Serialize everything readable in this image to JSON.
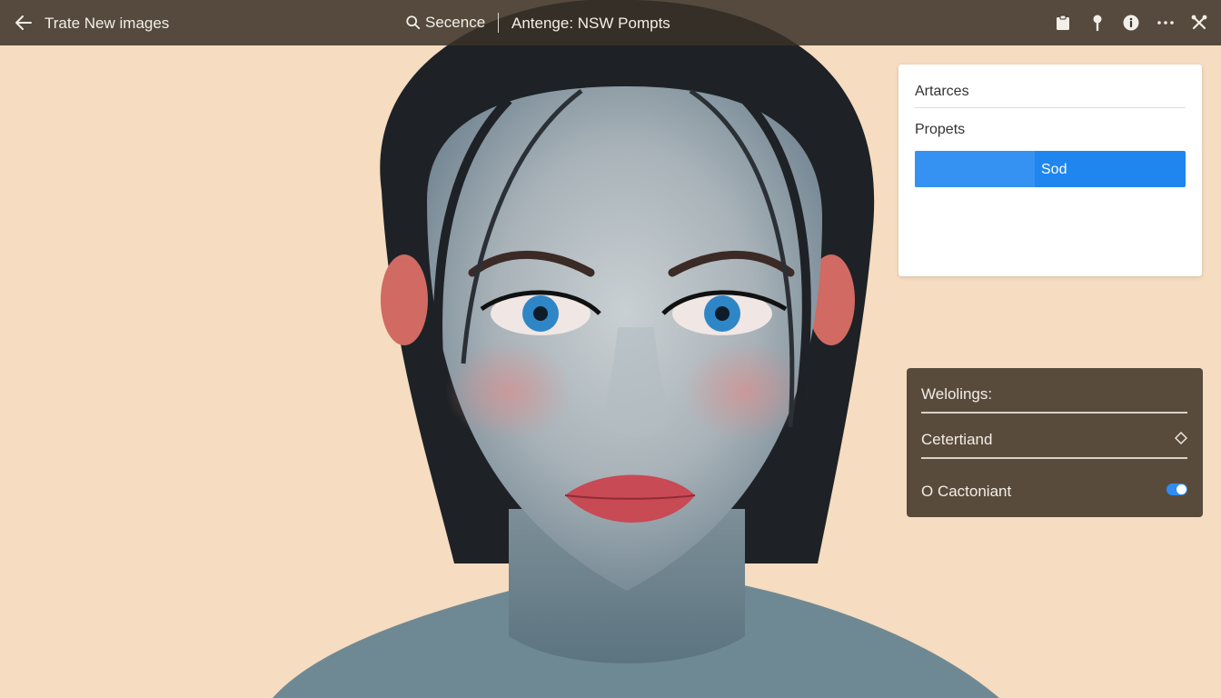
{
  "topbar": {
    "title": "Trate New images",
    "search_label": "Secence",
    "prompt_label": "Antenge: NSW Pompts",
    "icons": [
      "back-arrow-icon",
      "search-icon",
      "clipboard-icon",
      "pin-icon",
      "info-icon",
      "more-icon",
      "tools-icon"
    ]
  },
  "panel_light": {
    "item_1": "Artarces",
    "item_2": "Propets",
    "button_label": "Sod"
  },
  "panel_dark": {
    "heading": "Welolings:",
    "option_1": "Cetertiand",
    "option_2": "O Cactoniant",
    "option_2_enabled": true
  },
  "colors": {
    "background": "#f6dcc0",
    "topbar": "#3a3228",
    "accent_blue": "#1f86f0",
    "dark_panel": "#4c4032"
  }
}
